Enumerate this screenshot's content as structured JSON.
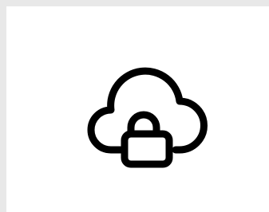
{
  "colors": {
    "page_background": "#e8e8e8",
    "panel_background": "#ffffff",
    "icon_stroke": "#000000"
  },
  "icon": {
    "name": "cloud-lock-icon"
  }
}
